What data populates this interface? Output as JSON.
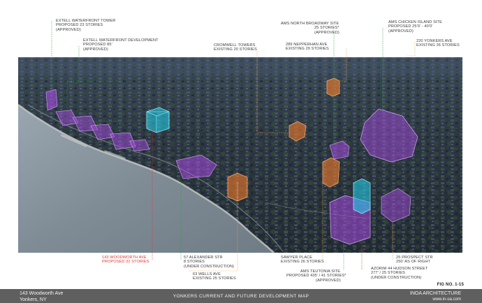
{
  "labels": {
    "extell_tower": [
      "EXTELL WATERFRONT TOWER",
      "PROPOSED 23 STORIES",
      "(APPROVED)"
    ],
    "extell_dev": [
      "EXTELL WATERFRONT DEVELOPMENT",
      "PROPOSED 85'",
      "(APPROVED)"
    ],
    "cromwell": [
      "CROMWELL TOWERS",
      "EXISTING 20 STORIES"
    ],
    "ams_north": [
      "AMS NORTH BROADWAY SITE",
      "25 STORIES*",
      "(APPROVED)"
    ],
    "nepperhan": [
      "289 NEPPERHAN AVE",
      "EXISTING 29 STORIES"
    ],
    "ams_chicken": [
      "AMS CHICKEN ISLAND SITE",
      "PROPOSED 25'0' - 40'0'",
      "(APPROVED)"
    ],
    "yonkers220": [
      "220 YONKERS AVE",
      "EXISTING 26 STORIES"
    ],
    "woodworth": [
      "143 WOODWORTH AVE",
      "PROPOSED 32 STORIES"
    ],
    "alexander": [
      "57 ALEXANDER STR",
      "8 STORIES",
      "(UNDER CONSTRUCTION)"
    ],
    "wells": [
      "63 WELLS AVE",
      "EXISTING 25 STORIES"
    ],
    "sawyer": [
      "SAWYER PLACE",
      "EXISTING 26 STORIES"
    ],
    "teutonia": [
      "AMS TEUTONIA SITE",
      "PROPOSED 435' / 41 STORIES*",
      "(APPROVED)"
    ],
    "azorim": [
      "AZORIM 44 HUDSON STREET",
      "277' / 25 STORIES",
      "(UNDER CONSTRUCTION)"
    ],
    "prospect": [
      "25 PROSPECT STR",
      "250' AS OF RIGHT"
    ]
  },
  "figure_number": "FIG NO. 1-15",
  "footer": {
    "address_line1": "143 Woodworth Ave",
    "address_line2": "Yonkers, NY",
    "title": "YONKERS CURRENT AND FUTURE DEVELOPMENT MAP",
    "firm": "INOA ARCHITECTURE",
    "website": "www.in-oa.com"
  },
  "colors": {
    "proposed": "#b14cf0",
    "existing": "#f07a2a",
    "subject": "#22d6f0",
    "leader_green": "#2fa14a",
    "leader_orange": "#f0a23a",
    "leader_red": "#e5322d",
    "footer_bg": "#5f5f5f"
  }
}
